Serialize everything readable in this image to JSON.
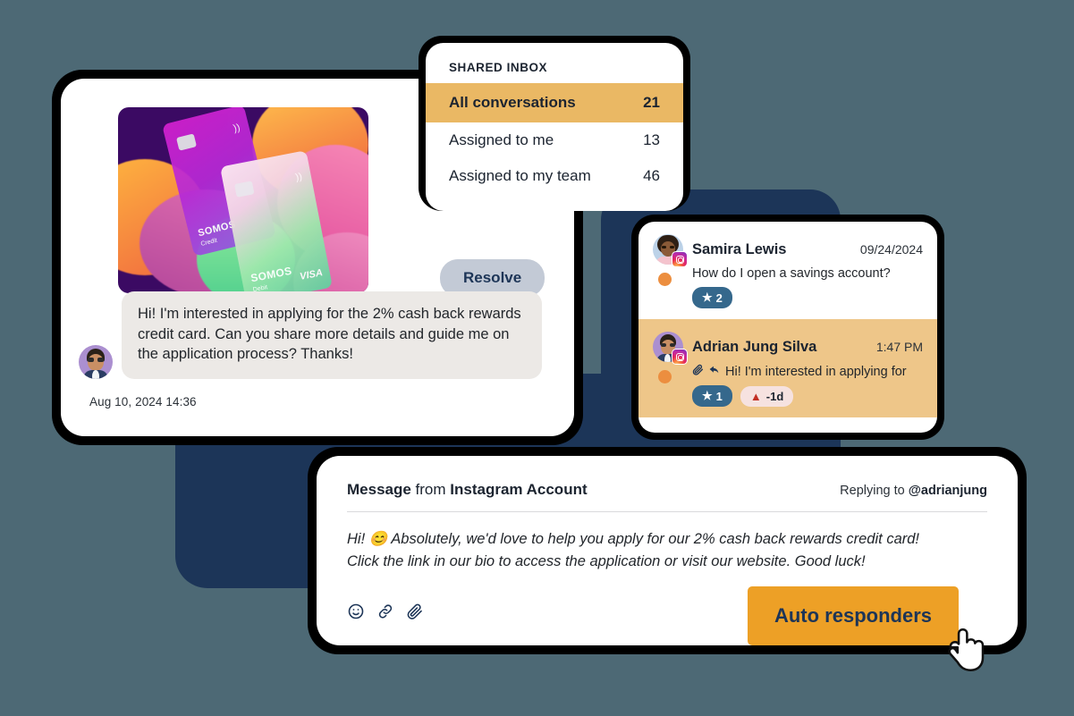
{
  "theme": {
    "page_background": "#4d6975",
    "navy": "#1c3558",
    "accent_orange": "#eda026",
    "highlight_amber": "#eab864",
    "selected_row": "#eec689",
    "badge_blue": "#35688c",
    "resolve_gray": "#c3cad6",
    "bubble_gray": "#ece9e6"
  },
  "conversation_panel": {
    "card_image": {
      "icon": "credit-card-promo-image",
      "background": "#3b0a63",
      "labels": [
        "SOMOS",
        "Credit",
        "SOMOS",
        "Debit",
        "VISA"
      ]
    },
    "resolve_label": "Resolve",
    "message": {
      "author_avatar": "adrian-avatar",
      "text": "Hi! I'm interested in applying for the 2% cash back rewards credit card. Can you share more details and guide me on the application process? Thanks!"
    },
    "timestamp": "Aug 10, 2024 14:36"
  },
  "shared_inbox": {
    "title": "SHARED INBOX",
    "items": [
      {
        "label": "All conversations",
        "count": "21",
        "active": true
      },
      {
        "label": "Assigned to me",
        "count": "13",
        "active": false
      },
      {
        "label": "Assigned to my team",
        "count": "46",
        "active": false
      }
    ]
  },
  "conversation_list": {
    "items": [
      {
        "name": "Samira Lewis",
        "time": "09/24/2024",
        "preview": "How do I open a savings account?",
        "channel_icon": "instagram-icon",
        "star_count": "2",
        "warning": null,
        "selected": false,
        "has_attachment": false,
        "has_reply": false,
        "unread_dot": true
      },
      {
        "name": "Adrian Jung Silva",
        "time": "1:47 PM",
        "preview": "Hi! I'm interested in applying for",
        "channel_icon": "instagram-icon",
        "star_count": "1",
        "warning": "-1d",
        "selected": true,
        "has_attachment": true,
        "has_reply": true,
        "unread_dot": true
      }
    ]
  },
  "composer": {
    "header_prefix": "Message",
    "header_middle": " from ",
    "header_account": "Instagram Account",
    "replying_prefix": "Replying to ",
    "replying_handle": "@adrianjung",
    "body_line_1": "Hi! 😊 Absolutely, we'd love to help you apply for our 2% cash back rewards credit card!",
    "body_line_2": "Click the link in our bio to access the application or visit our website. Good luck!",
    "tools": [
      "emoji-icon",
      "link-icon",
      "attachment-icon"
    ],
    "primary_button": "Auto responders"
  },
  "cursor": {
    "icon": "pointing-hand-cursor"
  }
}
